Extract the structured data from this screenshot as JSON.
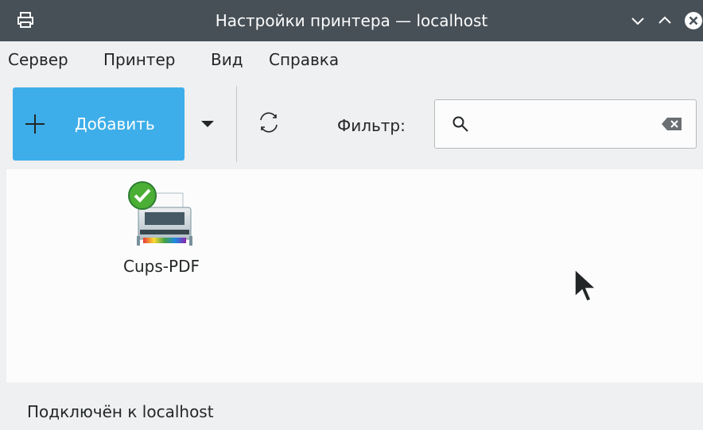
{
  "window": {
    "title": "Настройки принтера — localhost",
    "icons": {
      "app": "printer-icon",
      "minimize": "chevron-down-icon",
      "maximize": "chevron-up-icon",
      "close": "close-icon"
    }
  },
  "menubar": {
    "items": [
      {
        "label": "Сервер"
      },
      {
        "label": "Принтер"
      },
      {
        "label": "Вид"
      },
      {
        "label": "Справка"
      }
    ]
  },
  "toolbar": {
    "add_label": "Добавить",
    "add_icon": "plus-icon",
    "dropdown_icon": "caret-down-icon",
    "refresh_icon": "refresh-icon",
    "filter_label": "Фильтр:",
    "filter_value": "",
    "filter_placeholder": "",
    "search_icon": "search-icon",
    "clear_icon": "clear-text-icon"
  },
  "printers": [
    {
      "name": "Cups-PDF",
      "status": "ready",
      "status_icon": "checkmark-badge-icon"
    }
  ],
  "statusbar": {
    "text": "Подключён к localhost"
  },
  "colors": {
    "titlebar": "#475057",
    "accent": "#3daee9",
    "window_bg": "#eff0f1",
    "content_bg": "#fcfcfc",
    "text": "#232627",
    "ok_green": "#4caf35"
  }
}
